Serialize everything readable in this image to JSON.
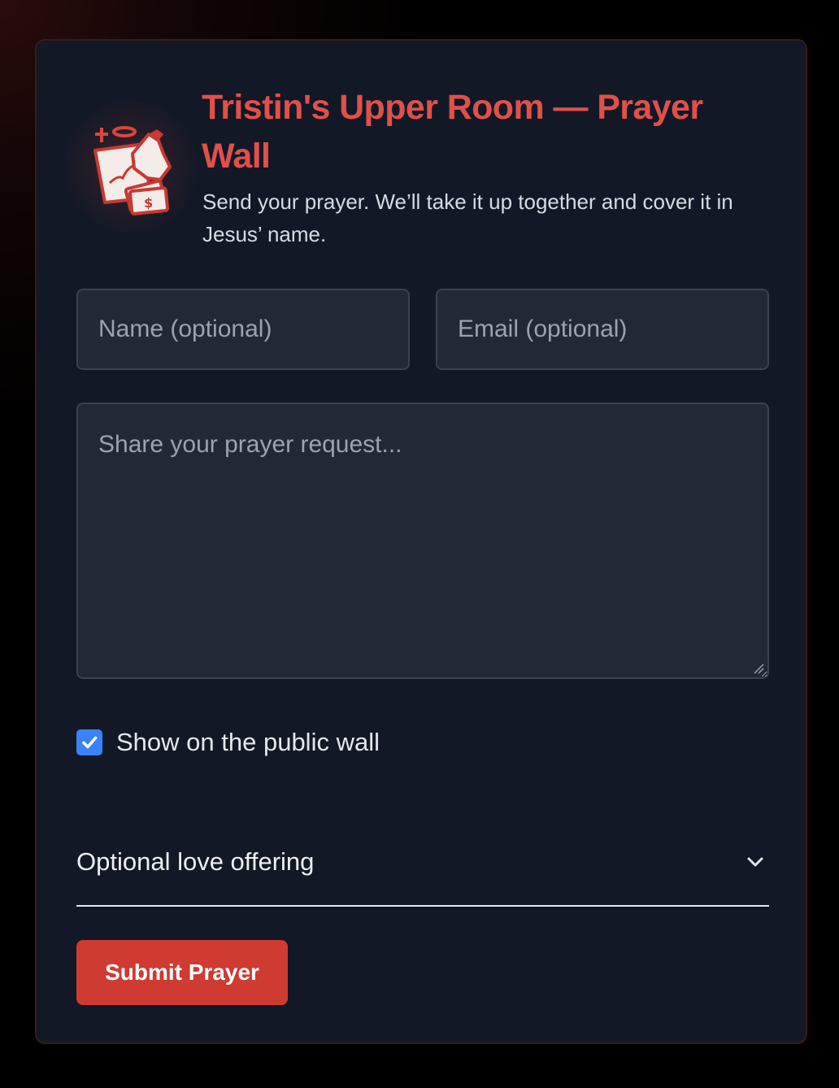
{
  "header": {
    "title": "Tristin's Upper Room — Prayer Wall",
    "subtitle": "Send your prayer. We’ll take it up together and cover it in Jesus’ name.",
    "logo_icon": "praying-hand-with-offering-icon"
  },
  "form": {
    "name_placeholder": "Name (optional)",
    "email_placeholder": "Email (optional)",
    "prayer_placeholder": "Share your prayer request...",
    "public_wall_label": "Show on the public wall",
    "public_wall_checked": true,
    "offering_label": "Optional love offering",
    "offering_icon": "chevron-down-icon",
    "submit_label": "Submit Prayer"
  },
  "colors": {
    "accent": "#e0504a",
    "button": "#cf3a31",
    "card_background": "#121826",
    "input_background": "#222836",
    "checkbox": "#3b82f6"
  }
}
